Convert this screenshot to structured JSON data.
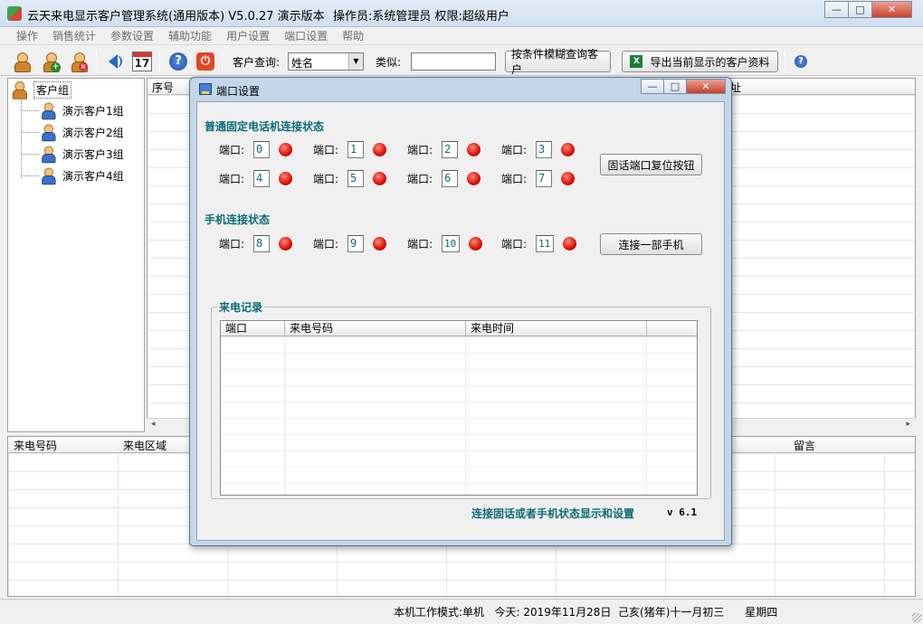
{
  "window": {
    "title": "云天来电显示客户管理系统(通用版本) V5.0.27  演示版本",
    "operator": "操作员:系统管理员  权限:超级用户",
    "controls": {
      "minimize": "—",
      "maximize": "□",
      "close": "✕"
    }
  },
  "menu": {
    "items": [
      "操作",
      "销售统计",
      "参数设置",
      "辅助功能",
      "用户设置",
      "端口设置",
      "帮助"
    ]
  },
  "toolbar": {
    "calendar_day": "17",
    "help_glyph": "?",
    "exit_glyph": "⏻",
    "query_label": "客户查询:",
    "query_field_value": "姓名",
    "similar_label": "类似:",
    "similar_value": "",
    "fuzzy_query_button": "按条件模糊查询客户",
    "export_button": "导出当前显示的客户资料",
    "help2_glyph": "?"
  },
  "tree": {
    "root": "客户组",
    "children": [
      "演示客户1组",
      "演示客户2组",
      "演示客户3组",
      "演示客户4组"
    ]
  },
  "top_grid": {
    "headers": {
      "seq": "序号",
      "addr_tail": "址"
    }
  },
  "bottom_grid": {
    "headers": {
      "caller_number": "来电号码",
      "caller_region": "来电区域",
      "message": "留言"
    }
  },
  "statusbar": {
    "text": "本机工作模式:单机   今天: 2019年11月28日  己亥(猪年)十一月初三      星期四"
  },
  "dialog": {
    "title": "端口设置",
    "landline_section": "普通固定电话机连接状态",
    "mobile_section": "手机连接状态",
    "port_label": "端口:",
    "landline_ports": [
      "0",
      "1",
      "2",
      "3",
      "4",
      "5",
      "6",
      "7"
    ],
    "mobile_ports": [
      "8",
      "9",
      "10",
      "11"
    ],
    "reset_button": "固话端口复位按钮",
    "connect_phone_button": "连接一部手机",
    "record_group": "来电记录",
    "record_columns": [
      "端口",
      "来电号码",
      "来电时间"
    ],
    "footer": "连接固话或者手机状态显示和设置",
    "version": "v 6.1",
    "led_color": "#e0150a"
  }
}
